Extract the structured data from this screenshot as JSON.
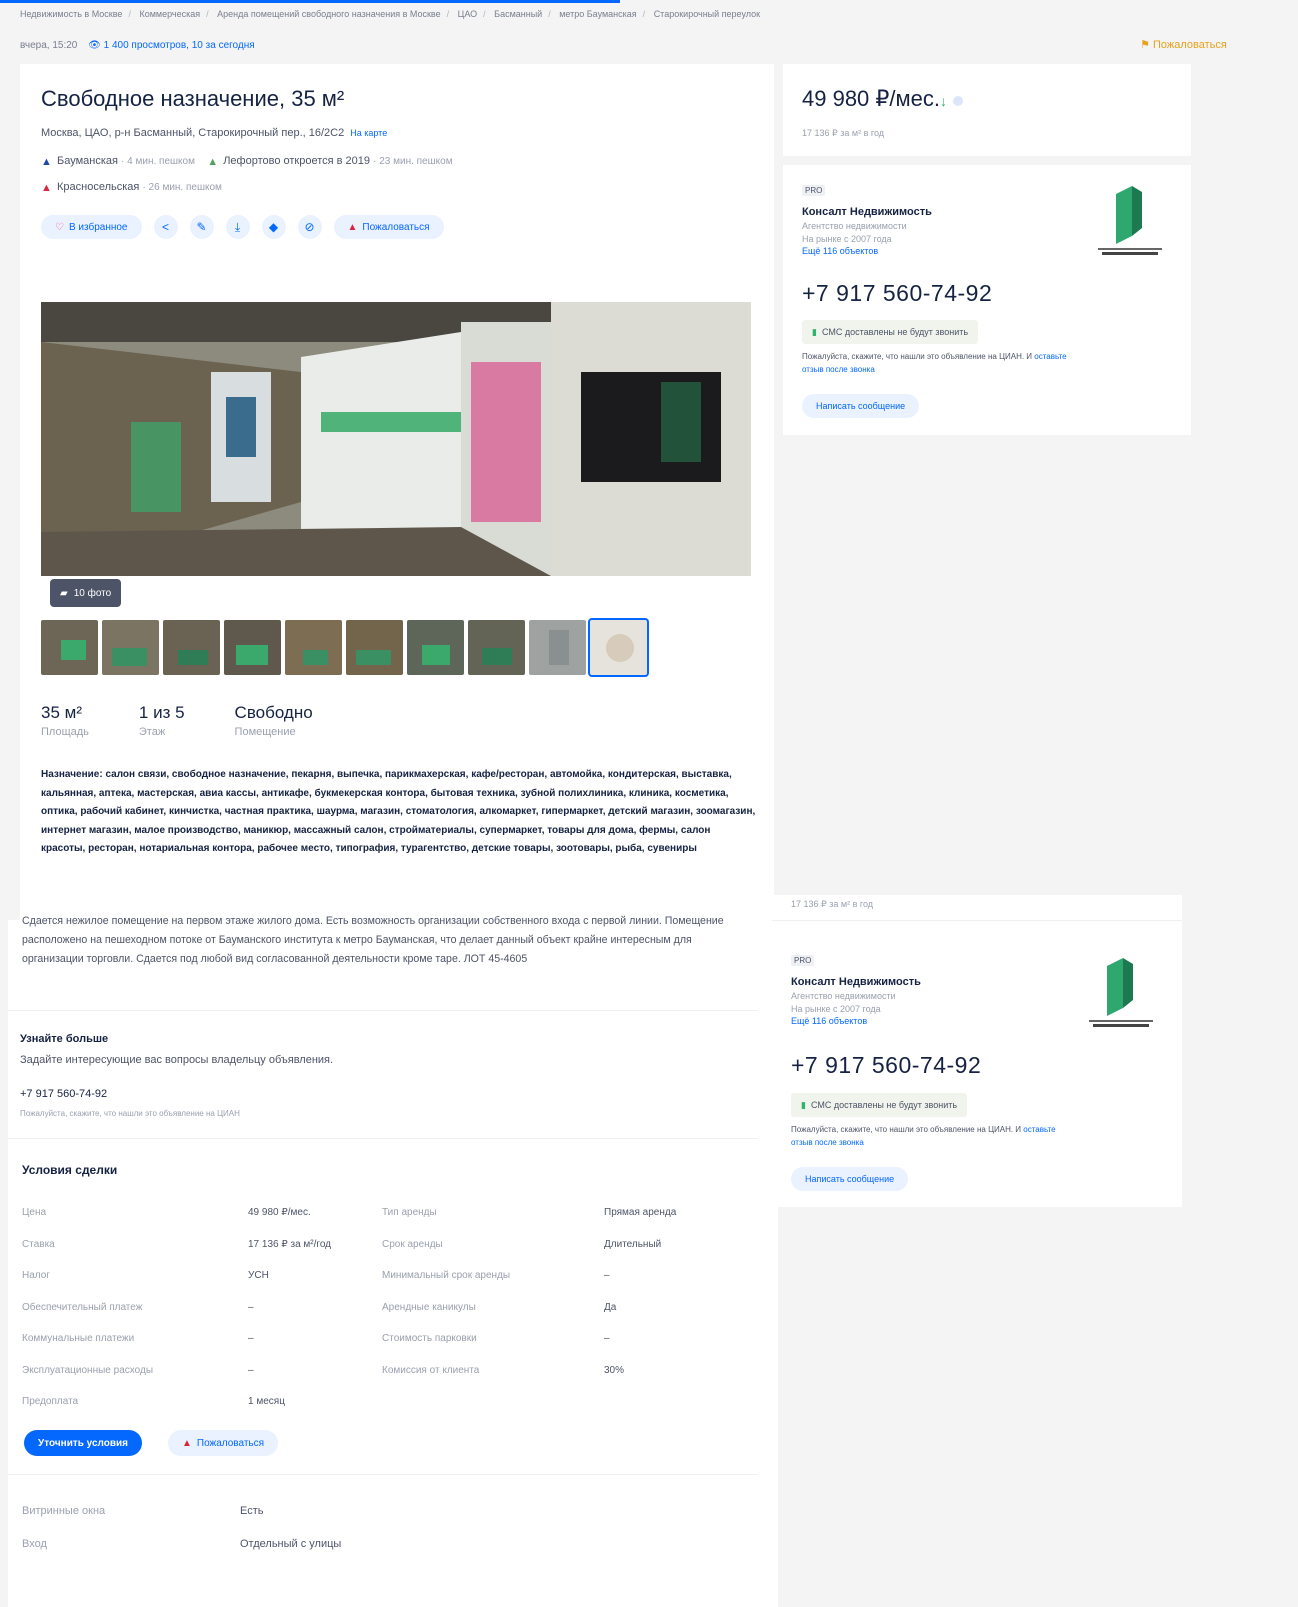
{
  "breadcrumbs": [
    "Недвижимость в Москве",
    "Коммерческая",
    "Аренда помещений свободного назначения в Москве",
    "ЦАО",
    "Басманный",
    "метро Бауманская",
    "Старокирочный переулок"
  ],
  "meta": {
    "updated": "вчера, 15:20",
    "views": "1 400 просмотров, 10 за сегодня",
    "complain": "Пожаловаться"
  },
  "listing": {
    "title": "Свободное назначение, 35 м²",
    "address": "Москва, ЦАО, р-н Басманный, Старокирочный пер., 16/2С2",
    "map_link": "На карте",
    "metro": [
      {
        "name": "Бауманская",
        "time": "4 мин. пешком",
        "color": "#1d4aa8"
      },
      {
        "name": "Лефортово откроется в 2019",
        "time": "23 мин. пешком",
        "color": "#52a35f"
      },
      {
        "name": "Красносельская",
        "time": "26 мин. пешком",
        "color": "#d7263d"
      }
    ],
    "actions": {
      "favorite": "В избранное",
      "complain": "Пожаловаться"
    },
    "photo_count": "10 фото",
    "facts": [
      {
        "value": "35 м²",
        "label": "Площадь"
      },
      {
        "value": "1 из 5",
        "label": "Этаж"
      },
      {
        "value": "Свободно",
        "label": "Помещение"
      }
    ],
    "purpose": "Назначение: салон связи, свободное назначение, пекарня, выпечка, парикмахерская, кафе/ресторан, автомойка, кондитерская, выставка, кальянная, аптека, мастерская, авиа кассы, антикафе, букмекерская контора, бытовая техника, зубной полихлиника, клиника, косметика, оптика, рабочий кабинет, кинчистка, частная практика, шаурма, магазин, стоматология, алкомаркет, гипермаркет, детский магазин, зоомагазин, интернет магазин, малое производство, маникюр, массажный салон, стройматериалы, супермаркет, товары для дома, фермы, салон красоты, ресторан, нотариальная контора, рабочее место, типография, турагентство, детские товары, зоотовары, рыба, сувениры",
    "description": "Сдается нежилое помещение на первом этаже жилого дома. Есть возможность организации собственного входа с первой линии. Помещение расположено на пешеходном потоке от Бауманского института к метро Бауманская, что делает данный объект крайне интересным для организации торговли. Сдается под любой вид согласованной деятельности кроме таре. ЛОТ 45-4605"
  },
  "learn_more": {
    "title": "Узнайте больше",
    "subtitle": "Задайте интересующие вас вопросы владельцу объявления.",
    "phone": "+7 917 560-74-92",
    "note": "Пожалуйста, скажите, что нашли это объявление на ЦИАН"
  },
  "conditions": {
    "title": "Условия сделки",
    "rows": [
      {
        "k1": "Цена",
        "v1": "49 980 ₽/мес.",
        "k2": "Тип аренды",
        "v2": "Прямая аренда"
      },
      {
        "k1": "Ставка",
        "v1": "17 136 ₽ за м²/год",
        "k2": "Срок аренды",
        "v2": "Длительный"
      },
      {
        "k1": "Налог",
        "v1": "УСН",
        "k2": "Минимальный срок аренды",
        "v2": "–"
      },
      {
        "k1": "Обеспечительный платеж",
        "v1": "–",
        "k2": "Арендные каникулы",
        "v2": "Да"
      },
      {
        "k1": "Коммунальные платежи",
        "v1": "–",
        "k2": "Стоимость парковки",
        "v2": "–"
      },
      {
        "k1": "Эксплуатационные расходы",
        "v1": "–",
        "k2": "Комиссия от клиента",
        "v2": "30%"
      },
      {
        "k1": "Предоплата",
        "v1": "1 месяц",
        "k2": "",
        "v2": ""
      }
    ],
    "clarify_button": "Уточнить условия",
    "complain_button": "Пожаловаться"
  },
  "extra": [
    {
      "k": "Витринные окна",
      "v": "Есть"
    },
    {
      "k": "Вход",
      "v": "Отдельный с улицы"
    }
  ],
  "sidebar": {
    "price": "49 980 ₽/мес.",
    "price_per_m": "17 136 ₽ за м² в год",
    "agent": {
      "badge": "PRO",
      "name": "Консалт Недвижимость",
      "type": "Агентство недвижимости",
      "since": "На рынке с 2007 года",
      "more": "Ещё 116 объектов",
      "phone": "+7 917 560-74-92",
      "sms": "СМС доставлены не будут звонить",
      "note_text": "Пожалуйста, скажите, что нашли это объявление на ЦИАН. И",
      "note_link": "оставьте отзыв после звонка",
      "message_button": "Написать сообщение"
    }
  },
  "colors": {
    "accent": "#0468ff",
    "text": "#152242",
    "muted": "#9aa0ae",
    "green": "#2bb56f"
  }
}
